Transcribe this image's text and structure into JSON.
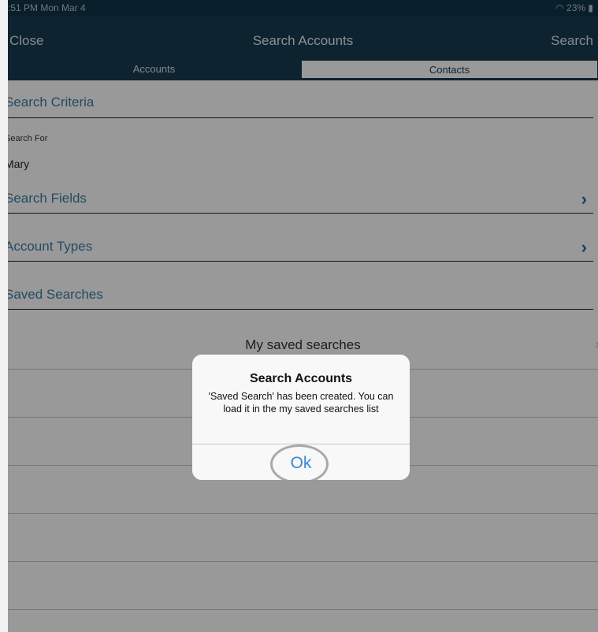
{
  "status_bar": {
    "time": ":51 PM  Mon Mar 4",
    "battery": "23%"
  },
  "nav": {
    "close_label": "Close",
    "title": "Search Accounts",
    "search_label": "Search"
  },
  "segments": [
    {
      "label": "Accounts"
    },
    {
      "label": "Contacts"
    }
  ],
  "sections": {
    "search_criteria": "Search Criteria",
    "search_for_label": "Search For",
    "search_for_value": "Mary",
    "search_fields": "Search Fields",
    "account_types": "Account Types",
    "saved_searches": "Saved Searches"
  },
  "saved_list": {
    "my_saved_searches": "My saved searches"
  },
  "alert": {
    "title": "Search Accounts",
    "message": "'Saved Search' has been created. You can load it in the my saved searches list",
    "ok": "Ok"
  }
}
